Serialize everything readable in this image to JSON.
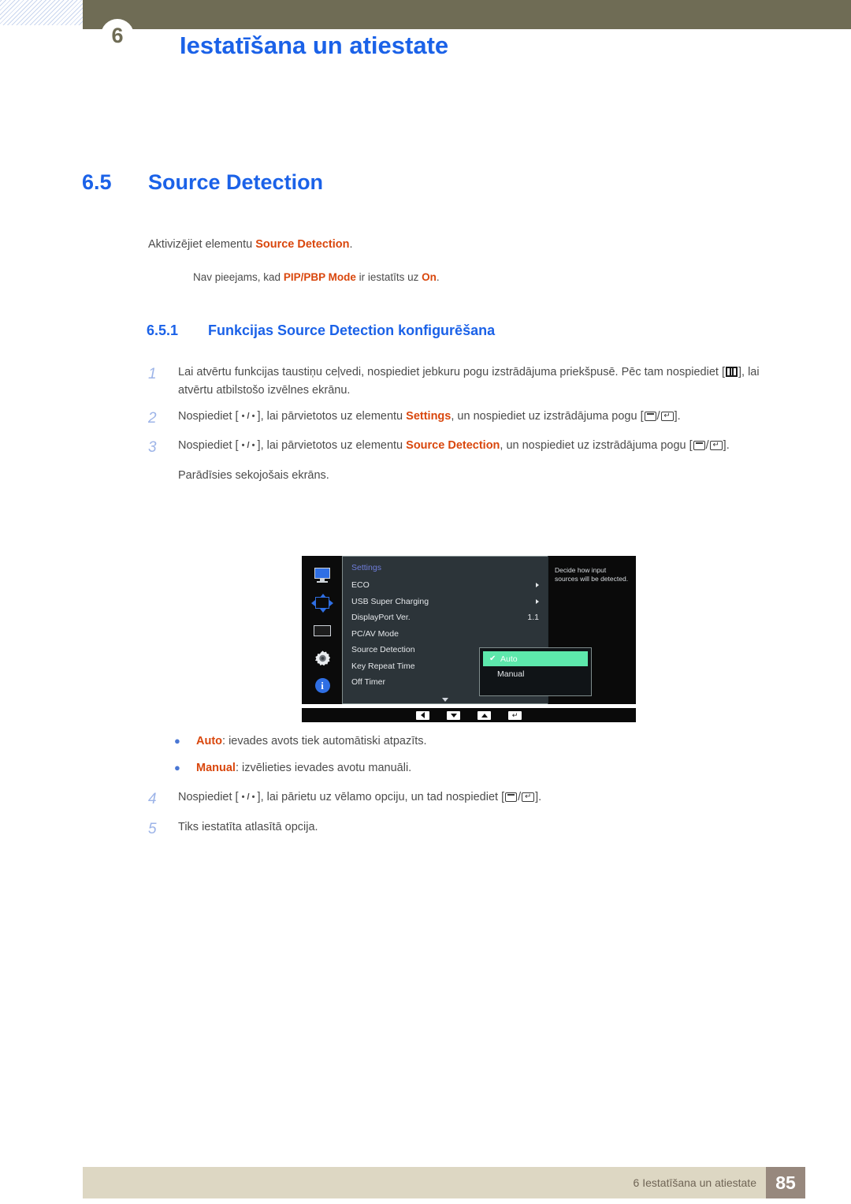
{
  "header": {
    "chapter_number": "6",
    "title": "Iestatīšana un atiestate"
  },
  "section": {
    "number": "6.5",
    "title": "Source Detection",
    "intro_prefix": "Aktivizējiet elementu ",
    "intro_term": "Source Detection",
    "intro_suffix": ".",
    "note_prefix": "Nav pieejams, kad ",
    "note_term1": "PIP/PBP Mode",
    "note_middle": " ir iestatīts uz ",
    "note_term2": "On",
    "note_suffix": "."
  },
  "subsection": {
    "number": "6.5.1",
    "title": "Funkcijas Source Detection konfigurēšana"
  },
  "steps": [
    {
      "number": "1",
      "part1": "Lai atvērtu funkcijas taustiņu ceļvedi, nospiediet jebkuru pogu izstrādājuma priekšpusē. Pēc tam nospiediet [",
      "part2": "], lai atvērtu atbilstošo izvēlnes ekrānu."
    },
    {
      "number": "2",
      "part1": "Nospiediet [ ",
      "dots": " • / • ",
      "part2": " ], lai pārvietotos uz elementu ",
      "term": "Settings",
      "part3": ", un nospiediet uz izstrādājuma pogu [",
      "part4": "]."
    },
    {
      "number": "3",
      "part1": "Nospiediet [ ",
      "part2": " ], lai pārvietotos uz elementu ",
      "term": "Source Detection",
      "part3": ", un nospiediet uz izstrādājuma pogu [",
      "part4": "].",
      "sub_line": "Parādīsies sekojošais ekrāns."
    }
  ],
  "steps_after": [
    {
      "number": "4",
      "part1": "Nospiediet [ ",
      "part2": " ], lai pārietu uz vēlamo opciju, un tad nospiediet [",
      "part3": "]."
    },
    {
      "number": "5",
      "part1": "Tiks iestatīta atlasītā opcija."
    }
  ],
  "bullets": [
    {
      "term": "Auto",
      "text": ": ievades avots tiek automātiski atpazīts."
    },
    {
      "term": "Manual",
      "text": ": izvēlieties ievades avotu manuāli."
    }
  ],
  "osd": {
    "title": "Settings",
    "rail_icons": [
      "monitor-icon",
      "picture-size-icon",
      "osd-display-icon",
      "gear-icon",
      "info-icon"
    ],
    "rows": [
      {
        "label": "ECO",
        "value": "",
        "has_arrow": true
      },
      {
        "label": "USB Super Charging",
        "value": "",
        "has_arrow": true
      },
      {
        "label": "DisplayPort Ver.",
        "value": "1.1",
        "has_arrow": false
      },
      {
        "label": "PC/AV Mode",
        "value": "",
        "has_arrow": false
      },
      {
        "label": "Source Detection",
        "value": "",
        "has_arrow": false
      },
      {
        "label": "Key Repeat Time",
        "value": "",
        "has_arrow": false
      },
      {
        "label": "Off Timer",
        "value": "",
        "has_arrow": false
      }
    ],
    "dropdown": {
      "selected": "Auto",
      "options": [
        "Auto",
        "Manual"
      ],
      "check_glyph": "✔"
    },
    "help_text": "Decide how input sources will be detected.",
    "control_buttons": [
      "left-arrow-button",
      "down-arrow-button",
      "up-arrow-button",
      "enter-button"
    ],
    "highlight_color": "#5de8ac",
    "title_color": "#6f7ddb"
  },
  "footer": {
    "text": "6 Iestatīšana un atiestate",
    "page": "85"
  },
  "colors": {
    "heading_blue": "#1b62e8",
    "highlight_orange": "#d9470d",
    "header_band": "#6f6c55",
    "footer_bar": "#ddd7c3",
    "footer_page_box": "#97887d"
  }
}
